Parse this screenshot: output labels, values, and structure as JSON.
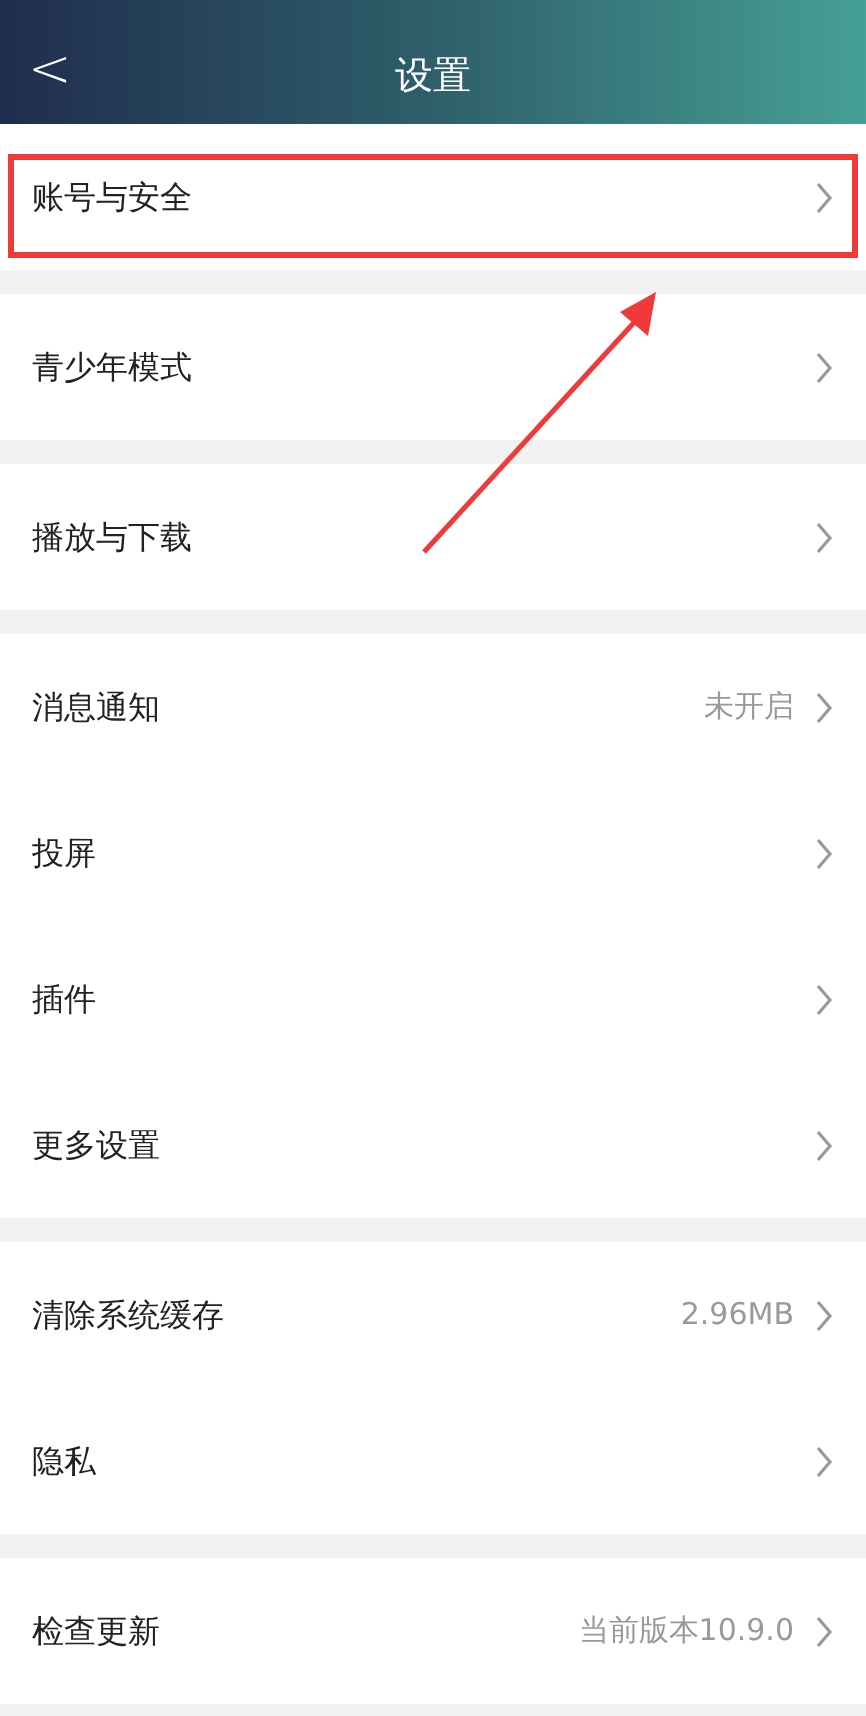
{
  "header": {
    "title": "设置",
    "back": "<"
  },
  "groups": [
    {
      "items": [
        {
          "label": "账号与安全",
          "highlighted": true
        }
      ]
    },
    {
      "items": [
        {
          "label": "青少年模式",
          "highlighted": false
        }
      ]
    },
    {
      "items": [
        {
          "label": "播放与下载",
          "highlighted": false
        }
      ]
    },
    {
      "items": [
        {
          "label": "消息通知",
          "value": "未开启",
          "highlighted": false
        },
        {
          "label": "投屏",
          "highlighted": false
        },
        {
          "label": "插件",
          "highlighted": false
        },
        {
          "label": "更多设置",
          "highlighted": false
        }
      ]
    },
    {
      "items": [
        {
          "label": "清除系统缓存",
          "value": "2.96MB",
          "highlighted": false
        },
        {
          "label": "隐私",
          "highlighted": false
        }
      ]
    },
    {
      "items": [
        {
          "label": "检查更新",
          "value": "当前版本10.9.0",
          "highlighted": false
        }
      ]
    }
  ]
}
